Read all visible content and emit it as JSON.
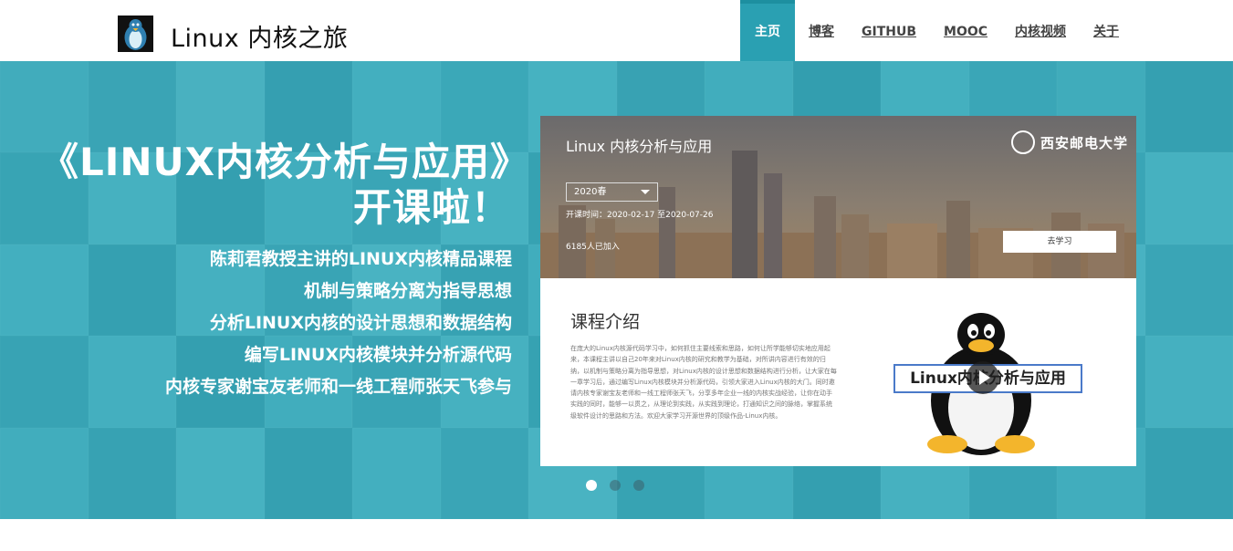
{
  "site": {
    "title": "Linux 内核之旅",
    "logo_icon": "tux-penguin-icon"
  },
  "nav": {
    "items": [
      {
        "label": "主页",
        "active": true
      },
      {
        "label": "博客",
        "active": false
      },
      {
        "label": "GITHUB",
        "active": false
      },
      {
        "label": "MOOC",
        "active": false
      },
      {
        "label": "内核视频",
        "active": false
      },
      {
        "label": "关于",
        "active": false
      }
    ]
  },
  "hero": {
    "headline": "《LINUX内核分析与应用》开课啦！",
    "bullets": [
      "陈莉君教授主讲的LINUX内核精品课程",
      "机制与策略分离为指导思想",
      "分析LINUX内核的设计思想和数据结构",
      "编写LINUX内核模块并分析源代码",
      "内核专家谢宝友老师和一线工程师张天飞参与"
    ]
  },
  "course_card": {
    "title": "Linux 内核分析与应用",
    "school": "西安邮电大学",
    "term": "2020春",
    "dates": "开课时间：2020-02-17 至2020-07-26",
    "joined": "6185人已加入",
    "learn_button": "去学习",
    "intro_title": "课程介绍",
    "intro_text": "在庞大的Linux内核源代码学习中，如何抓住主要线索和思路，如何让所学能够切实地应用起来，本课程主讲以自己20年来对Linux内核的研究和教学为基础，对所讲内容进行有效的归纳，以机制与策略分离为指导思想，对Linux内核的设计思想和数据结构进行分析，让大家在每一章学习后，通过编写Linux内核模块并分析源代码，引领大家进入Linux内核的大门。同时邀请内核专家谢宝友老师和一线工程师张天飞，分享多年企业一线的内核实战经验，让你在动手实践的同时，能够一以贯之，从理论到实践，从实践到理论，打通知识之间的脉络，掌握系统级软件设计的思路和方法。欢迎大家学习开源世界的顶级作品-Linux内核。",
    "promo_label": "Linux内核分析与应用"
  },
  "carousel": {
    "count": 3,
    "active_index": 0
  },
  "colors": {
    "accent": "#2aa0b2",
    "hero_bg": "#3aabbd"
  }
}
